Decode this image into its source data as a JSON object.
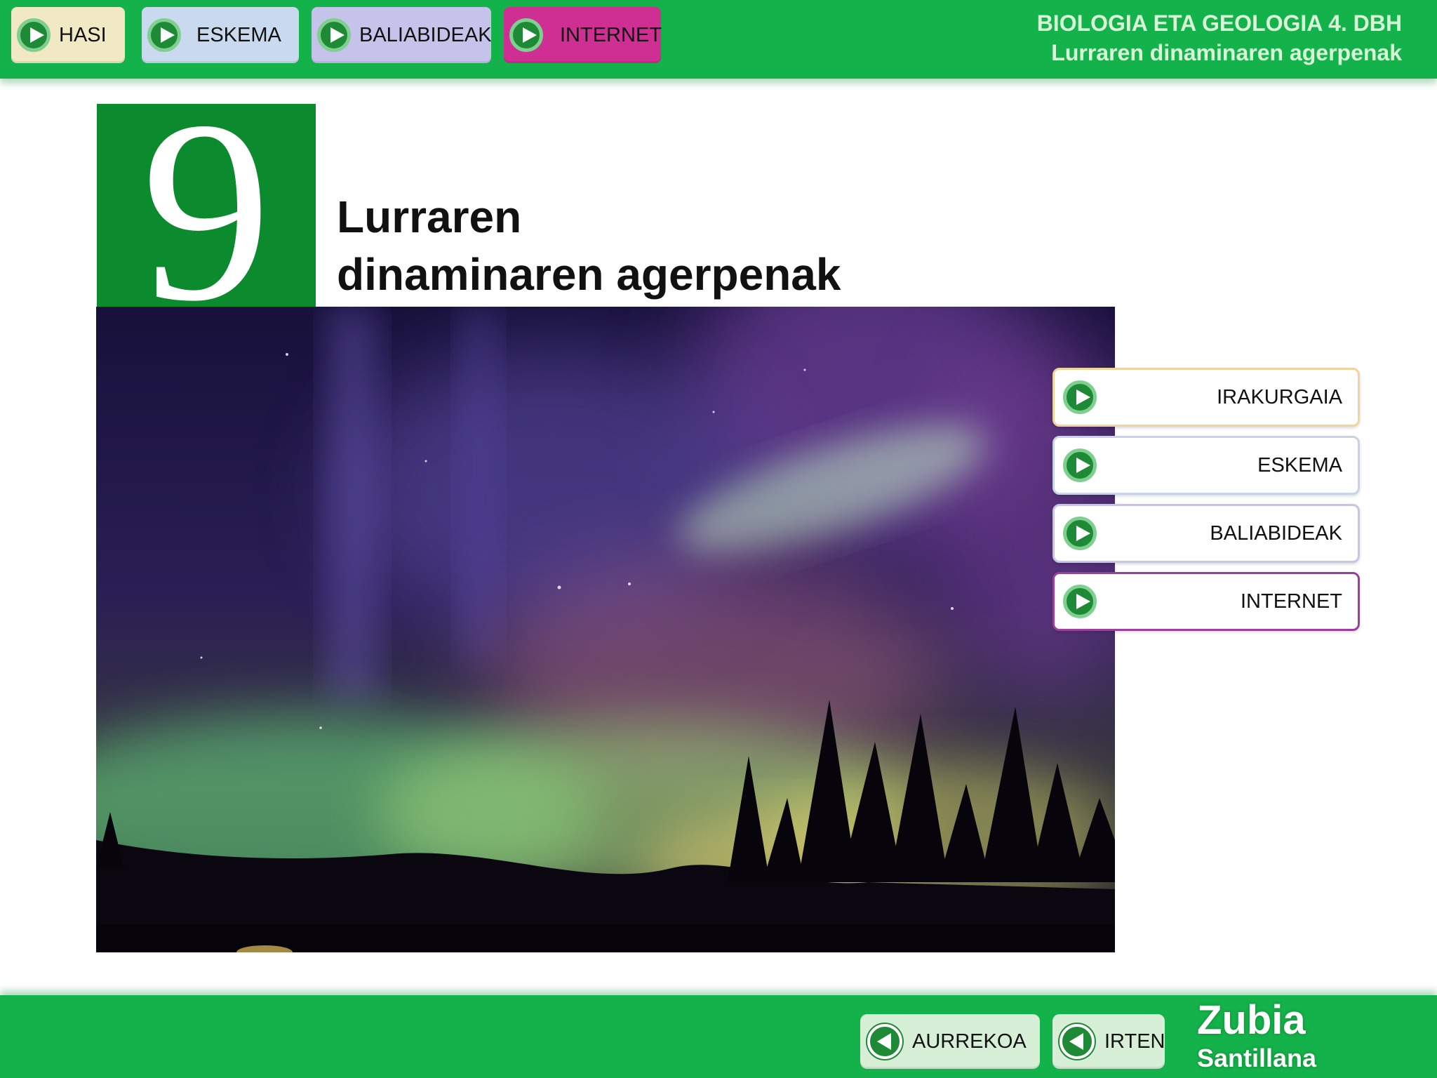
{
  "header": {
    "nav": [
      {
        "label": "HASI",
        "bg": "#f1e8c4"
      },
      {
        "label": "ESKEMA",
        "bg": "#c9d9ee"
      },
      {
        "label": "BALIABIDEAK",
        "bg": "#c5c3ea"
      },
      {
        "label": "INTERNET",
        "bg": "#cf2e93"
      }
    ],
    "course_title": "BIOLOGIA ETA GEOLOGIA 4. DBH",
    "unit_title": "Lurraren dinaminaren agerpenak"
  },
  "main": {
    "unit_number": "9",
    "title_line1": "Lurraren",
    "title_line2": "dinaminaren agerpenak"
  },
  "menu": [
    {
      "label": "IRAKURGAIA",
      "border": "#f0d49a"
    },
    {
      "label": "ESKEMA",
      "border": "#c9d3e6"
    },
    {
      "label": "BALIABIDEAK",
      "border": "#c9c3e6"
    },
    {
      "label": "INTERNET",
      "border": "#9a3f9c"
    }
  ],
  "footer": {
    "prev_label": "AURREKOA",
    "exit_label": "IRTEN",
    "brand_line1": "Zubia",
    "brand_line2": "Santillana"
  },
  "colors": {
    "bar_green": "#14b24a",
    "number_box": "#0c8a2e",
    "icon_green": "#1f8a36"
  }
}
